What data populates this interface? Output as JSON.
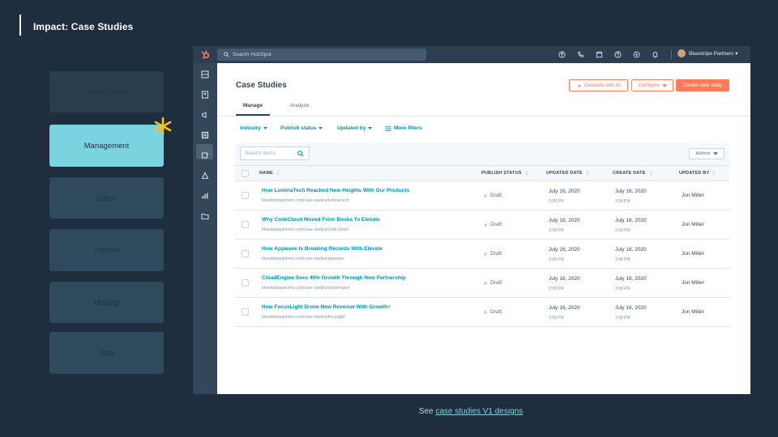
{
  "slide": {
    "title": "Impact: Case Studies",
    "footer_prefix": "See ",
    "footer_link": "case studies V1 designs"
  },
  "nav": [
    {
      "label": "Case Studies",
      "state": "inactive"
    },
    {
      "label": "Management",
      "state": "active"
    },
    {
      "label": "Editor",
      "state": "inactive"
    },
    {
      "label": "Themes",
      "state": "inactive"
    },
    {
      "label": "Hosting",
      "state": "inactive"
    },
    {
      "label": "Data",
      "state": "inactive"
    }
  ],
  "topbar": {
    "search_placeholder": "Search HubSpot",
    "account_name": "Bluestripe Partners ▾"
  },
  "page": {
    "title": "Case Studies",
    "btn_ai": "Generate with AI",
    "btn_configure": "Configure",
    "btn_create": "Create case study",
    "tab_manage": "Manage",
    "tab_analyze": "Analyze"
  },
  "filters": {
    "industry": "Industry",
    "publish_status": "Publish status",
    "updated_by": "Updated by",
    "more": "More filters"
  },
  "table": {
    "search_placeholder": "Search items",
    "actions": "Actions",
    "headers": {
      "name": "NAME",
      "status": "PUBLISH STATUS",
      "updated": "UPDATED DATE",
      "created": "CREATE DATE",
      "by": "UPDATED BY"
    },
    "rows": [
      {
        "title": "How LuminaTech Reached New Heights With Our Products",
        "url": "bluestripepartners.com/case-studies/lumina-tech",
        "status": "Draft",
        "updated_date": "July 16, 2020",
        "updated_time": "3:08 PM",
        "created_date": "July 16, 2020",
        "created_time": "3:08 PM",
        "user": "Jon Miller"
      },
      {
        "title": "Why CodeCloud Moved From Boska To Elevate",
        "url": "bluestripepartners.com/case-studies/code-cloud",
        "status": "Draft",
        "updated_date": "July 16, 2020",
        "updated_time": "3:08 PM",
        "created_date": "July 16, 2020",
        "created_time": "3:08 PM",
        "user": "Jon Miller"
      },
      {
        "title": "How Appwave Is Breaking Records With Elevate",
        "url": "bluestripepartners.com/case-studies/appwave",
        "status": "Draft",
        "updated_date": "July 16, 2020",
        "updated_time": "3:08 PM",
        "created_date": "July 16, 2020",
        "created_time": "3:08 PM",
        "user": "Jon Miller"
      },
      {
        "title": "CloudEngine Sees 40% Growth Through New Partnership",
        "url": "bluestripepartners.com/case-studies/cloudengine",
        "status": "Draft",
        "updated_date": "July 16, 2020",
        "updated_time": "3:08 PM",
        "created_date": "July 16, 2020",
        "created_time": "3:08 PM",
        "user": "Jon Miller"
      },
      {
        "title": "How FocusLight Drove New Revenue With Growth+",
        "url": "bluestripepartners.com/case-studies/focuslight",
        "status": "Draft",
        "updated_date": "July 16, 2020",
        "updated_time": "3:08 PM",
        "created_date": "July 16, 2020",
        "created_time": "3:08 PM",
        "user": "Jon Miller"
      }
    ]
  },
  "colors": {
    "background": "#1e2e3f",
    "accent_teal": "#7ad4e0",
    "hubspot_orange": "#ff7a59",
    "link_blue": "#0091ae",
    "spark_yellow": "#f5c518"
  }
}
